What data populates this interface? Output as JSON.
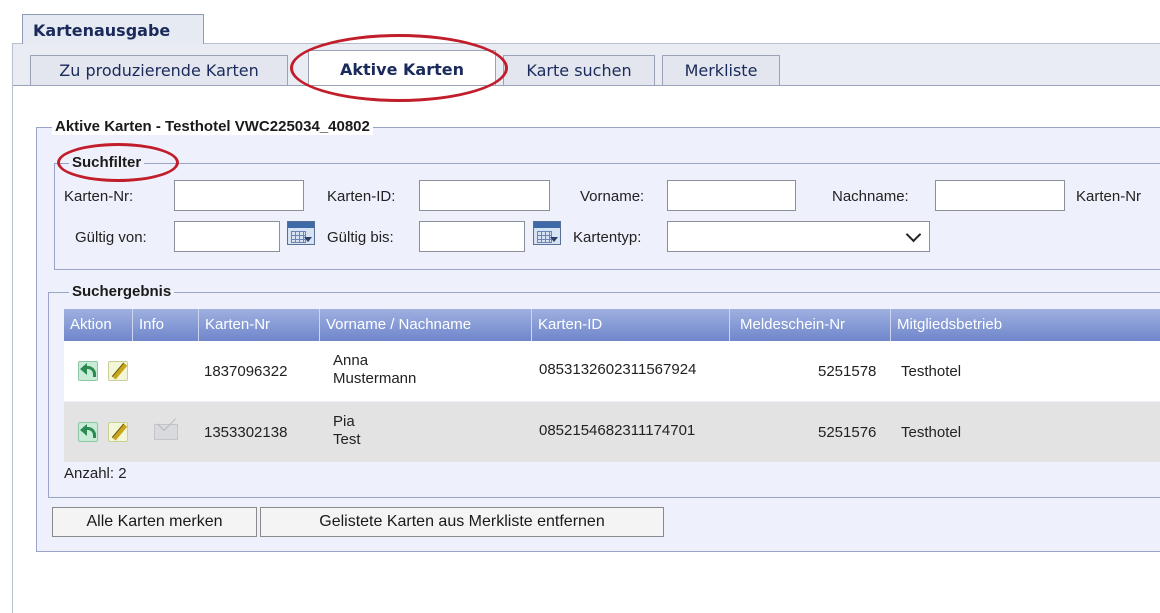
{
  "outer_tab": {
    "label": "Kartenausgabe"
  },
  "tabs": [
    {
      "label": "Zu produzierende Karten"
    },
    {
      "label": "Aktive Karten"
    },
    {
      "label": "Karte suchen"
    },
    {
      "label": "Merkliste"
    }
  ],
  "panel": {
    "title": "Aktive Karten - Testhotel VWC225034_40802"
  },
  "filter": {
    "title": "Suchfilter",
    "karten_nr_label": "Karten-Nr:",
    "karten_id_label": "Karten-ID:",
    "vorname_label": "Vorname:",
    "nachname_label": "Nachname:",
    "karten_nr2_label": "Karten-Nr",
    "gueltig_von_label": "Gültig von:",
    "gueltig_bis_label": "Gültig bis:",
    "kartentyp_label": "Kartentyp:",
    "values": {
      "karten_nr": "",
      "karten_id": "",
      "vorname": "",
      "nachname": "",
      "gueltig_von": "",
      "gueltig_bis": "",
      "kartentyp": ""
    }
  },
  "results": {
    "title": "Suchergebnis",
    "columns": [
      "Aktion",
      "Info",
      "Karten-Nr",
      "Vorname / Nachname",
      "Karten-ID",
      "Meldeschein-Nr",
      "Mitgliedsbetrieb"
    ],
    "rows": [
      {
        "karten_nr": "1837096322",
        "vorname": "Anna",
        "nachname": "Mustermann",
        "karten_id": "0853132602311567924",
        "meldeschein_nr": "5251578",
        "mitgliedsbetrieb": "Testhotel",
        "has_mail": false
      },
      {
        "karten_nr": "1353302138",
        "vorname": "Pia",
        "nachname": "Test",
        "karten_id": "0852154682311174701",
        "meldeschein_nr": "5251576",
        "mitgliedsbetrieb": "Testhotel",
        "has_mail": true
      }
    ],
    "count_label": "Anzahl: 2"
  },
  "buttons": {
    "remember_all": "Alle Karten merken",
    "remove_listed": "Gelistete Karten aus Merkliste entfernen"
  },
  "colors": {
    "annotation_red": "#c11d2a",
    "header_blue": "#6f86cb",
    "panel_bg": "#eef0fb"
  }
}
